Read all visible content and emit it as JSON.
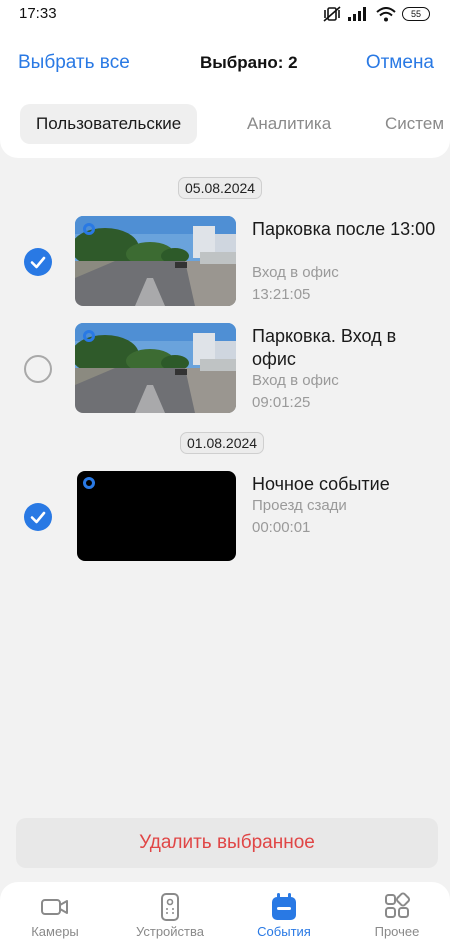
{
  "status_bar": {
    "time": "17:33",
    "battery": "55"
  },
  "header": {
    "select_all": "Выбрать все",
    "selected_count": "Выбрано: 2",
    "cancel": "Отмена"
  },
  "tabs": [
    {
      "label": "Пользовательские",
      "active": true
    },
    {
      "label": "Аналитика",
      "active": false
    },
    {
      "label": "Систем",
      "active": false
    }
  ],
  "groups": [
    {
      "date": "05.08.2024",
      "events": [
        {
          "title": "Парковка после 13:00",
          "subtitle": "Вход в офис",
          "time": "13:21:05",
          "selected": true
        },
        {
          "title": "Парковка. Вход в офис",
          "subtitle": "Вход в офис",
          "time": "09:01:25",
          "selected": false
        }
      ]
    },
    {
      "date": "01.08.2024",
      "events": [
        {
          "title": "Ночное событие",
          "subtitle": "Проезд сзади",
          "time": "00:00:01",
          "selected": true
        }
      ]
    }
  ],
  "delete_label": "Удалить выбранное",
  "nav": [
    {
      "label": "Камеры",
      "icon": "camera-icon",
      "active": false
    },
    {
      "label": "Устройства",
      "icon": "device-remote-icon",
      "active": false
    },
    {
      "label": "События",
      "icon": "calendar-icon",
      "active": true
    },
    {
      "label": "Прочее",
      "icon": "grid-icon",
      "active": false
    }
  ],
  "colors": {
    "accent": "#2979e4",
    "danger": "#e04646",
    "background": "#f2f2f2"
  }
}
